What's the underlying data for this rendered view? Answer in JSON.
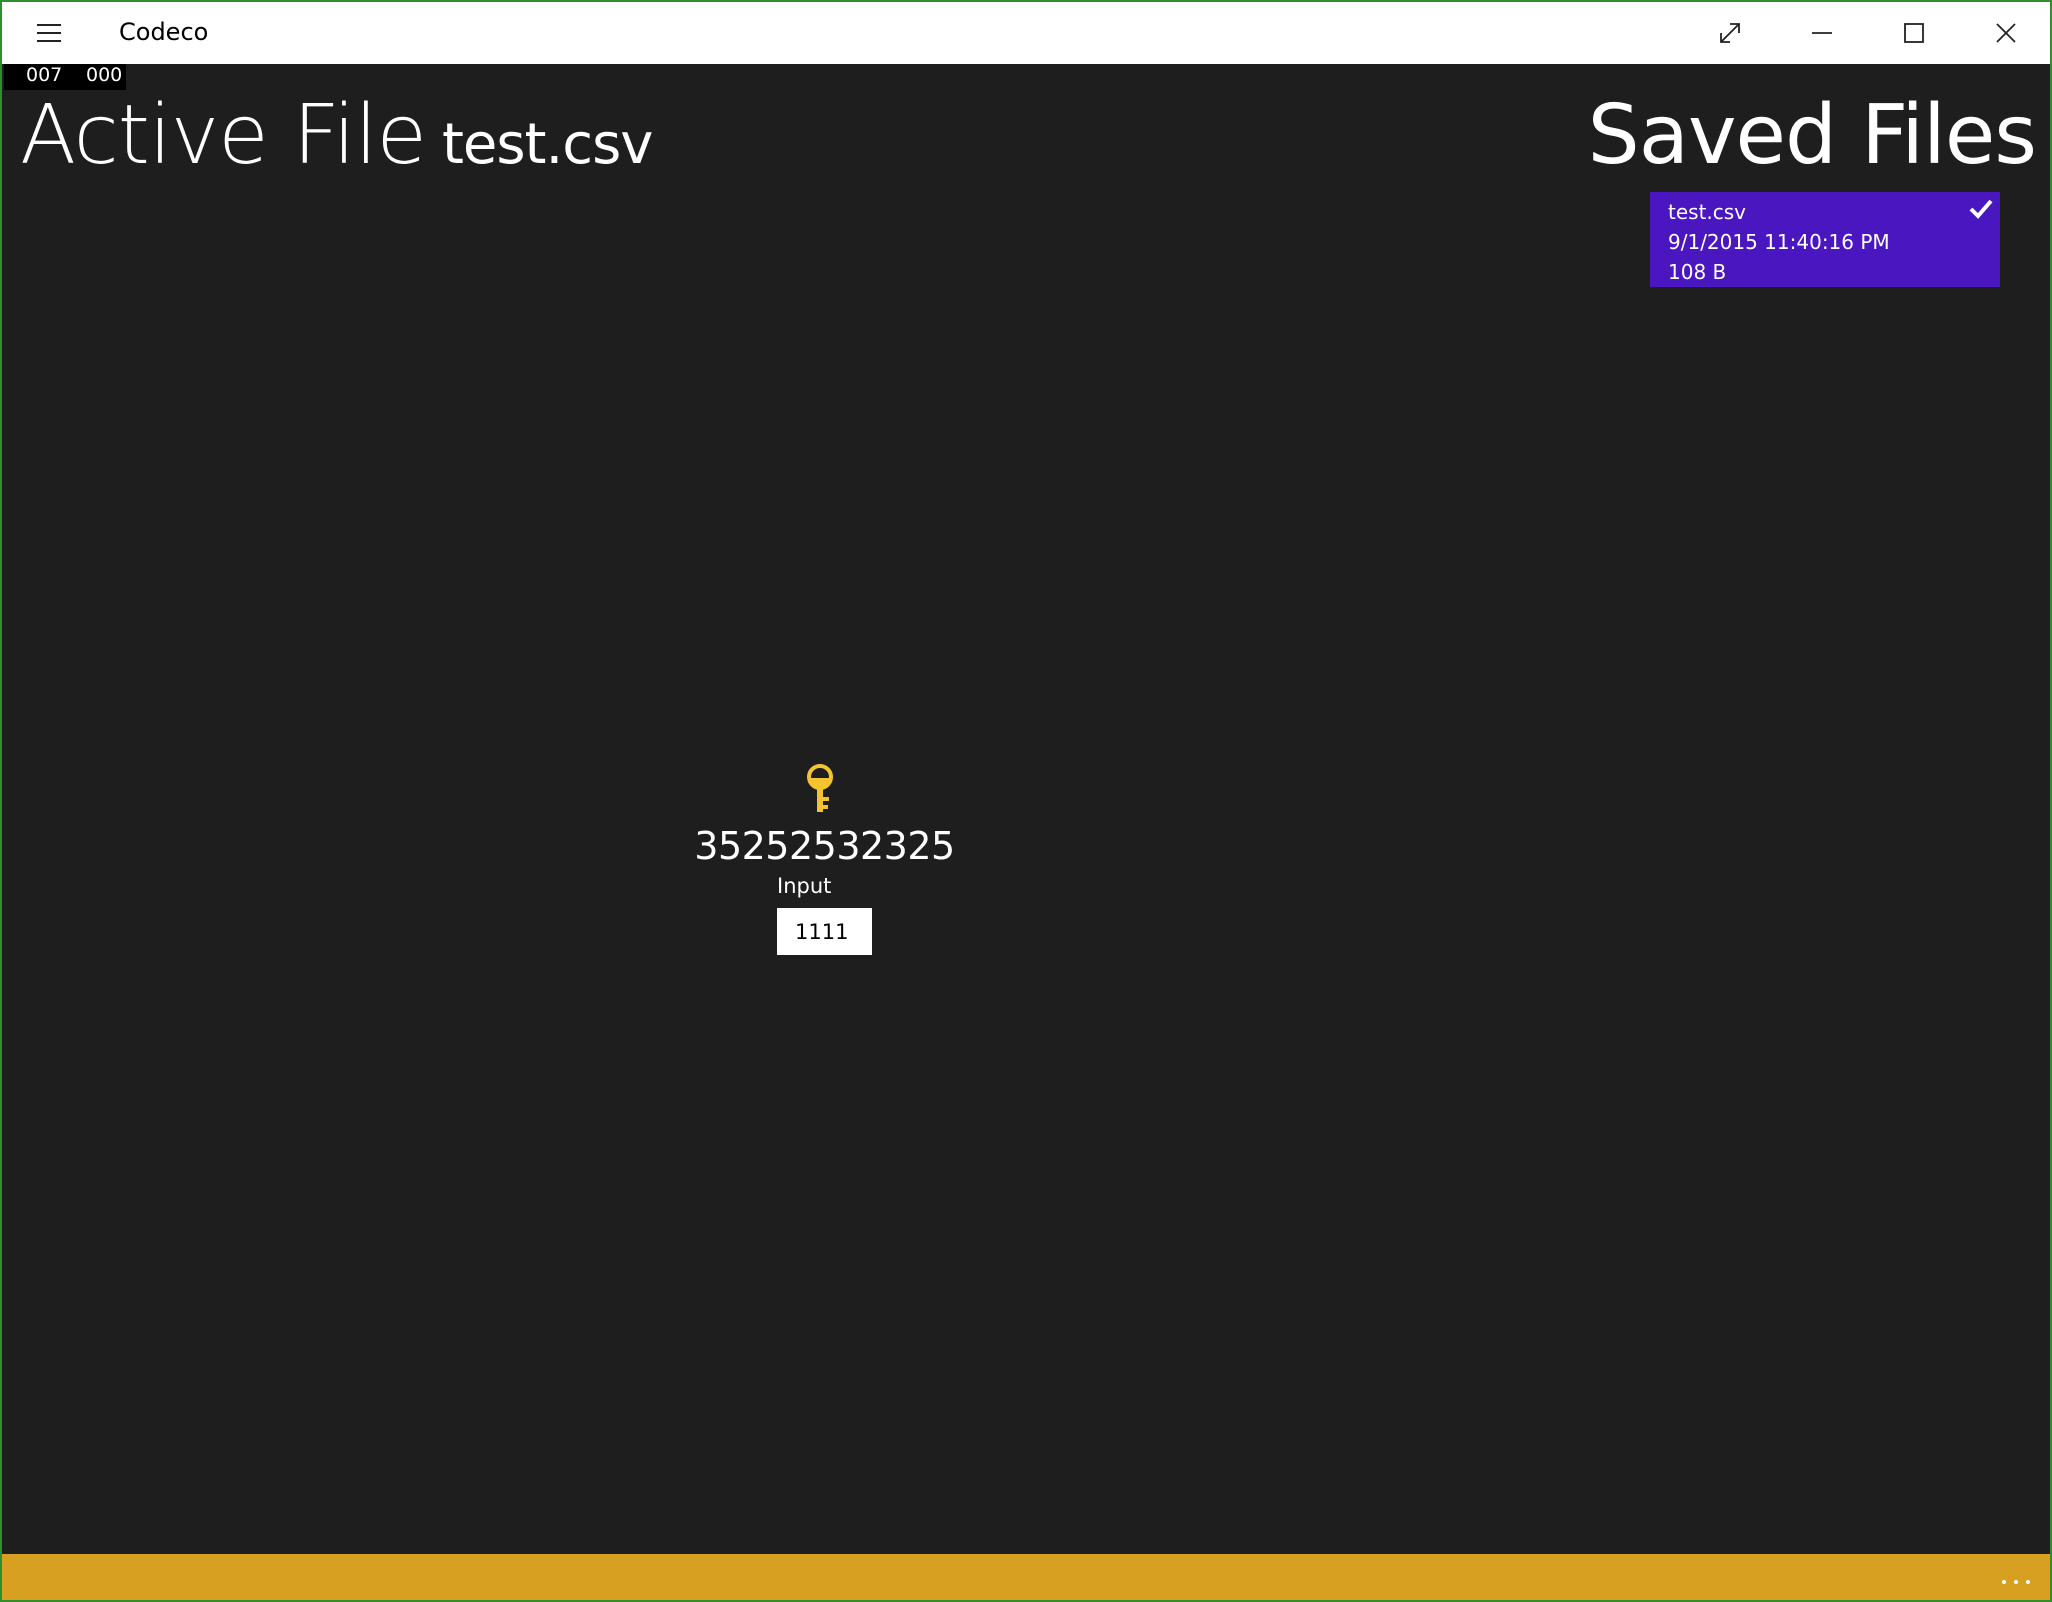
{
  "window": {
    "title": "Codeco",
    "border_color": "#2f8f2f"
  },
  "titlebar": {
    "menu_icon": "hamburger-icon",
    "buttons": [
      "resize-icon",
      "minimize-icon",
      "maximize-icon",
      "close-icon"
    ]
  },
  "counters": {
    "left": "007",
    "right": "000"
  },
  "active_file": {
    "label": "Active File",
    "name": "test.csv"
  },
  "saved_files": {
    "title": "Saved Files",
    "items": [
      {
        "name": "test.csv",
        "date": "9/1/2015 11:40:16 PM",
        "size": "108 B",
        "selected": true,
        "color": "#4a16c0"
      }
    ]
  },
  "main": {
    "icon": "key-icon",
    "icon_color": "#f4c430",
    "code": "35252532325",
    "input_label": "Input",
    "input_value": "1111"
  },
  "appbar": {
    "color": "#d8a020",
    "more_icon": "more-icon"
  }
}
